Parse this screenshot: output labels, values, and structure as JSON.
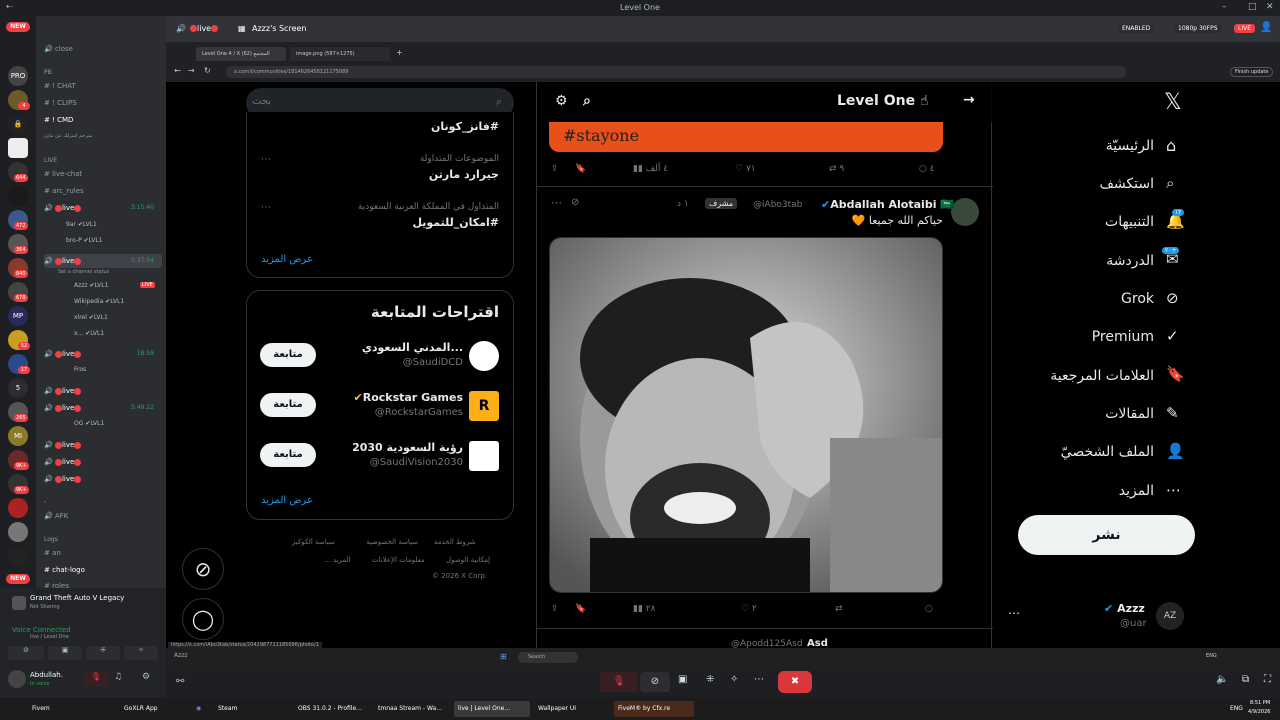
{
  "app": {
    "title": "Level One",
    "notif_badges": {
      "notifications": "١٢",
      "messages": "٢٠+"
    }
  },
  "header": {
    "server_name": "Level One",
    "channel": "live",
    "screen_title": "Azzz's Screen",
    "enabled_label": "ENABLED",
    "stream_quality": "1080p 30FPS",
    "live_label": "LIVE"
  },
  "servers": [
    {
      "label": "NEW",
      "badge": ""
    },
    {
      "label": "PRO",
      "badge": ""
    },
    {
      "label": "",
      "badge": "4"
    },
    {
      "label": "",
      "badge": ""
    },
    {
      "label": "",
      "badge": ""
    },
    {
      "label": "",
      "badge": "644"
    },
    {
      "label": "",
      "badge": ""
    },
    {
      "label": "",
      "badge": "472"
    },
    {
      "label": "",
      "badge": "364"
    },
    {
      "label": "",
      "badge": "840"
    },
    {
      "label": "",
      "badge": "679"
    },
    {
      "label": "MP",
      "badge": ""
    },
    {
      "label": "",
      "badge": "52"
    },
    {
      "label": "",
      "badge": "17"
    },
    {
      "label": "5",
      "badge": ""
    },
    {
      "label": "",
      "badge": "265"
    },
    {
      "label": "MI",
      "badge": ""
    },
    {
      "label": "",
      "badge": "9K+"
    },
    {
      "label": "",
      "badge": "9K+"
    },
    {
      "label": "",
      "badge": ""
    },
    {
      "label": "",
      "badge": ""
    },
    {
      "label": "",
      "badge": "9K+"
    }
  ],
  "channels": {
    "close": "close",
    "cat_pb": "PB",
    "chat": "! CHAT",
    "clips": "! CLIPS",
    "cmd": "! CMD",
    "arabic_note": "مترجم اسرلك عن ماين",
    "cat_live": "LIVE",
    "live_chat": "live-chat",
    "arc_rules": "arc_rules",
    "live": "live",
    "t1": "3:15:40",
    "t2": "5:37:54",
    "t3": "18:58",
    "t4": "5:49:22",
    "u_9ar": "9ar",
    "u_brop": "bro-P",
    "u_azzz": "Azzz",
    "u_wiki": "Wikipedia",
    "u_xlrel": "xlrel",
    "u_x": "x...",
    "u_fros": "Fros",
    "u_og": "OG",
    "lvl": "LVL1",
    "live_badge": "LIVE",
    "set_status": "Set a channel status",
    "afk": "AFK",
    "cat_logs": "Logs",
    "an": "an",
    "chat_logo": "chat-logo",
    "roles": "roles",
    "dash": "-"
  },
  "user_panel": {
    "game": "Grand Theft Auto V Legacy",
    "sharing": "Not Sharing",
    "voice_connected": "Voice Connected",
    "voice_channel": "live / Level One",
    "username": "Abdullah.",
    "status": "In voice"
  },
  "browser": {
    "tab1": "Level One 4 / X المجتمع (62)",
    "tab2": "image.png (587×1275)",
    "url": "x.com/i/communities/1814626458121175089",
    "finish_update": "Finish update",
    "status_url": "https://x.com/iAbo3tab/status/2042987711185096/photo/1"
  },
  "x_nav": {
    "home": "الرئيسيّة",
    "explore": "استكشف",
    "notifications": "التنبيهات",
    "messages": "الدردشة",
    "grok": "Grok",
    "premium": "Premium",
    "bookmarks": "العلامات المرجعية",
    "articles": "المقالات",
    "profile": "الملف الشخصيّ",
    "more": "المزيد",
    "post": "نشر",
    "account_name": "Azzz",
    "account_handle": "@uar"
  },
  "feed": {
    "community": "Level One",
    "banner_text": "#stayone",
    "stats1": {
      "views": "٤ آلف",
      "likes": "٧١",
      "reposts": "٩",
      "replies": "٤"
    },
    "post": {
      "name": "Abdallah Alotaibi",
      "handle": "@iAbo3tab",
      "role": "مشرف",
      "time": "١ د",
      "text": "حياكم الله جميعا 🧡"
    },
    "stats2": {
      "views": "٢٨",
      "likes": "٢"
    },
    "next_post": {
      "name": "Asd",
      "handle": "@Apodd125Asd",
      "time": "١ د"
    }
  },
  "sidebar": {
    "search_placeholder": "بحث",
    "trend1": "#فانز_كونان",
    "trend2_meta": "الموضوعات المتداولة",
    "trend2": "جيرارد مارتن",
    "trend3_meta": "المتداول في المملكة العربية السعودية",
    "trend3": "#امكان_للتمويل",
    "show_more": "عرض المزيد",
    "follow_title": "اقتراحات المتابعة",
    "follow": [
      {
        "name": "...المدني السعودي",
        "handle": "@SaudiDCD",
        "btn": "متابعة"
      },
      {
        "name": "Rockstar Games",
        "handle": "@RockstarGames",
        "btn": "متابعة"
      },
      {
        "name": "رؤية السعودية 2030",
        "handle": "@SaudiVision2030",
        "btn": "متابعة"
      }
    ],
    "footer": [
      "شروط الخدمة",
      "سياسة الخصوصية",
      "سياسة الكوكيز",
      "إمكانية الوصول",
      "معلومات الإعلانات",
      "... المزيد",
      "© 2026 X Corp."
    ]
  },
  "winbar": {
    "search": "Search",
    "label": "Azzz",
    "lang": "ENG"
  },
  "taskbar": {
    "items": [
      "Fivem",
      "GoXLR App",
      "Steam",
      "OBS 31.0.2 - Profile...",
      "tmnaa Stream - Wa...",
      "live | Level One...",
      "Wallpaper UI",
      "FiveM® by Cfx.re"
    ],
    "lang": "ENG",
    "time": "8:51 PM",
    "date": "4/9/2026"
  }
}
